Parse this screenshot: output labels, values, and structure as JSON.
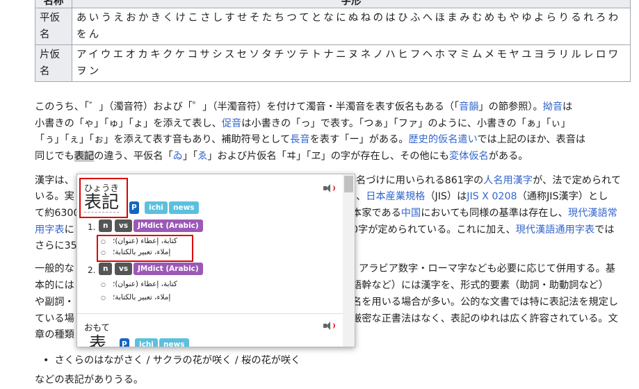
{
  "table": {
    "header_label": "名称",
    "header_value": "字形",
    "rows": [
      {
        "label": "平仮名",
        "value": "あいうえおかきくけこさしすせそたちつてとなにぬねのはひふへほまみむめもやゆよらりるれろわをん"
      },
      {
        "label": "片仮名",
        "value": "アイウエオカキクケコサシスセソタチツテトナニヌネノハヒフヘホマミムメモヤユヨラリルレロワヲン"
      }
    ]
  },
  "para1": {
    "t1": "このうち、「゛」（濁音符）および「゜」（半濁音符）を付けて濁音・半濁音を表す仮名もある（「",
    "link_onin": "音韻",
    "t2": "」の節参照）。",
    "link_youon": "拗音",
    "t3": "は",
    "t4": "小書きの「ゃ」「ゅ」「ょ」を添えて表し、",
    "link_sokuon": "促音",
    "t5": "は小書きの「っ」で表す。「つぁ」「ファ」のように、小書きの「ぁ」「ぃ」",
    "t6": "「ぅ」「ぇ」「ぉ」を添えて表す音もあり、補助符号として",
    "link_chouon": "長音",
    "t7": "を表す「ー」がある。",
    "link_rekishi": "歴史的仮名遣い",
    "t8": "では上記のほか、表音は",
    "t9": "同じでも",
    "sel": "表記",
    "t10": "の違う、平仮名「",
    "link_wi": "ゐ",
    "t11": "」「",
    "link_we": "ゑ",
    "t12": "」および片仮名「ヰ」「ヱ」の字が存在し、その他にも",
    "link_hentai": "変体仮名",
    "t13": "がある。"
  },
  "para2": {
    "l1a": "漢字は、",
    "l1b": "名づけに用いられる861字の",
    "link_jinmei": "人名用漢字",
    "l1c": "が、法で定められて",
    "l2a": "いる。実",
    "l2b": "、",
    "link_jis": "日本産業規格",
    "l2c": "（JIS）は",
    "link_jisx": "JIS X 0208",
    "l2d": "（通称JIS漢字）とし",
    "l3a": "て約6300",
    "l3b": "本家である",
    "link_china": "中国",
    "l3c": "においても同様の基準は存在し、",
    "link_xiandai": "現代漢語常",
    "link_xiandai2": "用字表",
    "l4a": "に",
    "l4b": "0字が定められている。これに加え、",
    "link_tongyong": "現代漢語通用字表",
    "l4c": "では",
    "l5a": "さらに35"
  },
  "para3": {
    "l1a": "一般的な",
    "l1b": "アラビア数字・ローマ字なども必要に応じて併用する。基",
    "l2a": "本的には",
    "l2b": "語幹など）には漢字を、形式的要素（助詞・助動詞など）",
    "l3a": "や副詞・",
    "l3b": "名を用いる場合が多い。公的な文書では特に表記法を規定し",
    "l4a": "ている場",
    "l4b": "厳密な正書法はなく、表記のゆれは広く許容されている。文",
    "l5a": "章の種類"
  },
  "bullet": "さくらのはながさく / サクラの花が咲く / 桜の花が咲く",
  "after": "などの表記がありうる。",
  "popup": {
    "entry1": {
      "reading": "ひょうき",
      "kanji": "表記",
      "tags": [
        "P",
        "ichi",
        "news"
      ],
      "senses": [
        {
          "num": "1.",
          "pos": [
            "n",
            "vs"
          ],
          "dict": "JMdict (Arabic)",
          "glosses": [
            "كتابة، إعطاء (عنوان)؛",
            "إملاء، تعبير بالكتابة؛"
          ]
        },
        {
          "num": "2.",
          "pos": [
            "n",
            "vs"
          ],
          "dict": "JMdict (Arabic)",
          "glosses": [
            "كتابة، إعطاء (عنوان)؛",
            "إملاء، تعبير بالكتابة؛"
          ]
        }
      ]
    },
    "entry2": {
      "reading": "おもて",
      "kanji": "表",
      "tags": [
        "P",
        "ichi",
        "news"
      ]
    }
  }
}
